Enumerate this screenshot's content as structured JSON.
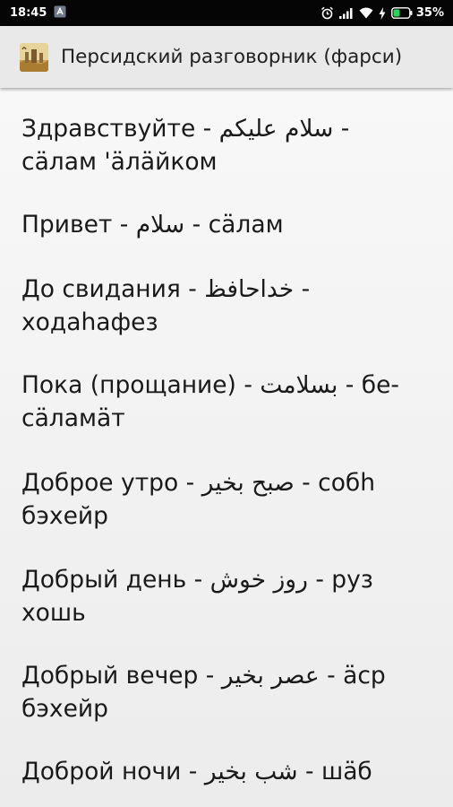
{
  "status_bar": {
    "time": "18:45",
    "battery": "35%",
    "icons": [
      "notification-icon",
      "alarm-icon",
      "signal-icon",
      "wifi-icon",
      "charging-icon",
      "battery-icon"
    ]
  },
  "app_bar": {
    "icon": "app-logo-icon",
    "title": "Персидский разговорник (фарси)"
  },
  "phrases": [
    {
      "line1": "Здравствуйте - سلام علیکم -",
      "line2": "сäлам 'äлäйком"
    },
    {
      "line1": "Привет - سلام - сäлам",
      "line2": ""
    },
    {
      "line1": "До свидания - خداحافظ -",
      "line2": "ходаhафез"
    },
    {
      "line1": "Пока (прощание) - بسلامت - бе-",
      "line2": "сäламäт"
    },
    {
      "line1": "Доброе утро - صبح بخیر - собh",
      "line2": "бэхейр"
    },
    {
      "line1": "Добрый день - روز خوش - руз",
      "line2": "хошь"
    },
    {
      "line1": "Добрый вечер - عصر بخیر - äср",
      "line2": "бэхейр"
    },
    {
      "line1": "Доброй ночи - شب بخیر - шäб",
      "line2": ""
    }
  ]
}
